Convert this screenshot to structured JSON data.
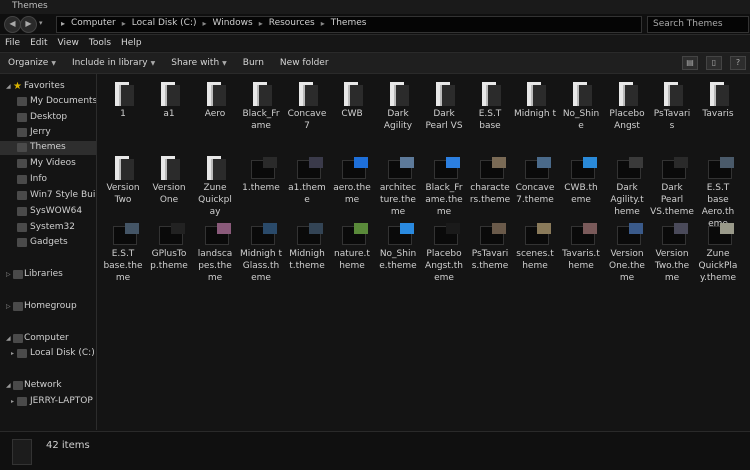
{
  "window": {
    "title": "Themes"
  },
  "address": {
    "crumbs": [
      "Computer",
      "Local Disk (C:)",
      "Windows",
      "Resources",
      "Themes"
    ],
    "search_placeholder": "Search Themes"
  },
  "menu": [
    "File",
    "Edit",
    "View",
    "Tools",
    "Help"
  ],
  "toolbar": [
    "Organize",
    "Include in library",
    "Share with",
    "Burn",
    "New folder"
  ],
  "sidebar": {
    "favorites_label": "Favorites",
    "favorites": [
      "My Documents",
      "Desktop",
      "Jerry",
      "Themes",
      "My Videos",
      "Info",
      "Win7 Style Buil",
      "SysWOW64",
      "System32",
      "Gadgets"
    ],
    "selected": "Themes",
    "libraries": "Libraries",
    "homegroup": "Homegroup",
    "computer": "Computer",
    "computer_children": [
      "Local Disk (C:)"
    ],
    "network": "Network",
    "network_children": [
      "JERRY-LAPTOP"
    ]
  },
  "items": [
    {
      "name": "1",
      "type": "folder"
    },
    {
      "name": "a1",
      "type": "folder"
    },
    {
      "name": "Aero",
      "type": "folder"
    },
    {
      "name": "Black_Fr ame",
      "type": "folder"
    },
    {
      "name": "Concave 7",
      "type": "folder"
    },
    {
      "name": "CWB",
      "type": "folder"
    },
    {
      "name": "Dark Agility",
      "type": "folder"
    },
    {
      "name": "Dark Pearl VS",
      "type": "folder"
    },
    {
      "name": "E.S.T base",
      "type": "folder"
    },
    {
      "name": "Midnigh t",
      "type": "folder"
    },
    {
      "name": "No_Shin e",
      "type": "folder"
    },
    {
      "name": "Placebo Angst",
      "type": "folder"
    },
    {
      "name": "PsTavari s",
      "type": "folder"
    },
    {
      "name": "Tavaris",
      "type": "folder"
    },
    {
      "name": "Version Two",
      "type": "folder"
    },
    {
      "name": "Version One",
      "type": "folder"
    },
    {
      "name": "Zune Quickpl ay",
      "type": "folder"
    },
    {
      "name": "1.theme",
      "type": "theme",
      "accent": "#2a2a2a"
    },
    {
      "name": "a1.them e",
      "type": "theme",
      "accent": "#3a3a4a"
    },
    {
      "name": "aero.the me",
      "type": "theme",
      "accent": "#1e6fd9"
    },
    {
      "name": "architec ture.the me",
      "type": "theme",
      "accent": "#5d7a9a"
    },
    {
      "name": "Black_Fr ame.the me",
      "type": "theme",
      "accent": "#2c7fe0"
    },
    {
      "name": "characte rs.theme",
      "type": "theme",
      "accent": "#7a6a55"
    },
    {
      "name": "Concave 7.theme",
      "type": "theme",
      "accent": "#4a6a8a"
    },
    {
      "name": "CWB.th eme",
      "type": "theme",
      "accent": "#2a8ad9"
    },
    {
      "name": "Dark Agility.t heme",
      "type": "theme",
      "accent": "#3a3a3a"
    },
    {
      "name": "Dark Pearl VS.theme",
      "type": "theme",
      "accent": "#2a2a2a"
    },
    {
      "name": "E.S.T base Aero.th eme",
      "type": "theme",
      "accent": "#4a5a6a"
    },
    {
      "name": "E.S.T base.the me",
      "type": "theme",
      "accent": "#445566"
    },
    {
      "name": "GPlusTo p.theme",
      "type": "theme",
      "accent": "#222222"
    },
    {
      "name": "landsca pes.the me",
      "type": "theme",
      "accent": "#8a5a7a"
    },
    {
      "name": "Midnigh t Glass.th eme",
      "type": "theme",
      "accent": "#2a4a6a"
    },
    {
      "name": "Midnigh t.theme",
      "type": "theme",
      "accent": "#334455"
    },
    {
      "name": "nature.t heme",
      "type": "theme",
      "accent": "#5a8a3a"
    },
    {
      "name": "No_Shin e.theme",
      "type": "theme",
      "accent": "#2a8ae0"
    },
    {
      "name": "Placebo Angst.th eme",
      "type": "theme",
      "accent": "#1a1a1a"
    },
    {
      "name": "PsTavari s.theme",
      "type": "theme",
      "accent": "#6a5a4a"
    },
    {
      "name": "scenes.t heme",
      "type": "theme",
      "accent": "#8a7a5a"
    },
    {
      "name": "Tavaris.t heme",
      "type": "theme",
      "accent": "#7a5a5a"
    },
    {
      "name": "Version One.the me",
      "type": "theme",
      "accent": "#3a5a8a"
    },
    {
      "name": "Version Two.the me",
      "type": "theme",
      "accent": "#4a4a5a"
    },
    {
      "name": "Zune QuickPla y.theme",
      "type": "theme",
      "accent": "#9a9a8a"
    }
  ],
  "status": {
    "count": "42 items"
  }
}
